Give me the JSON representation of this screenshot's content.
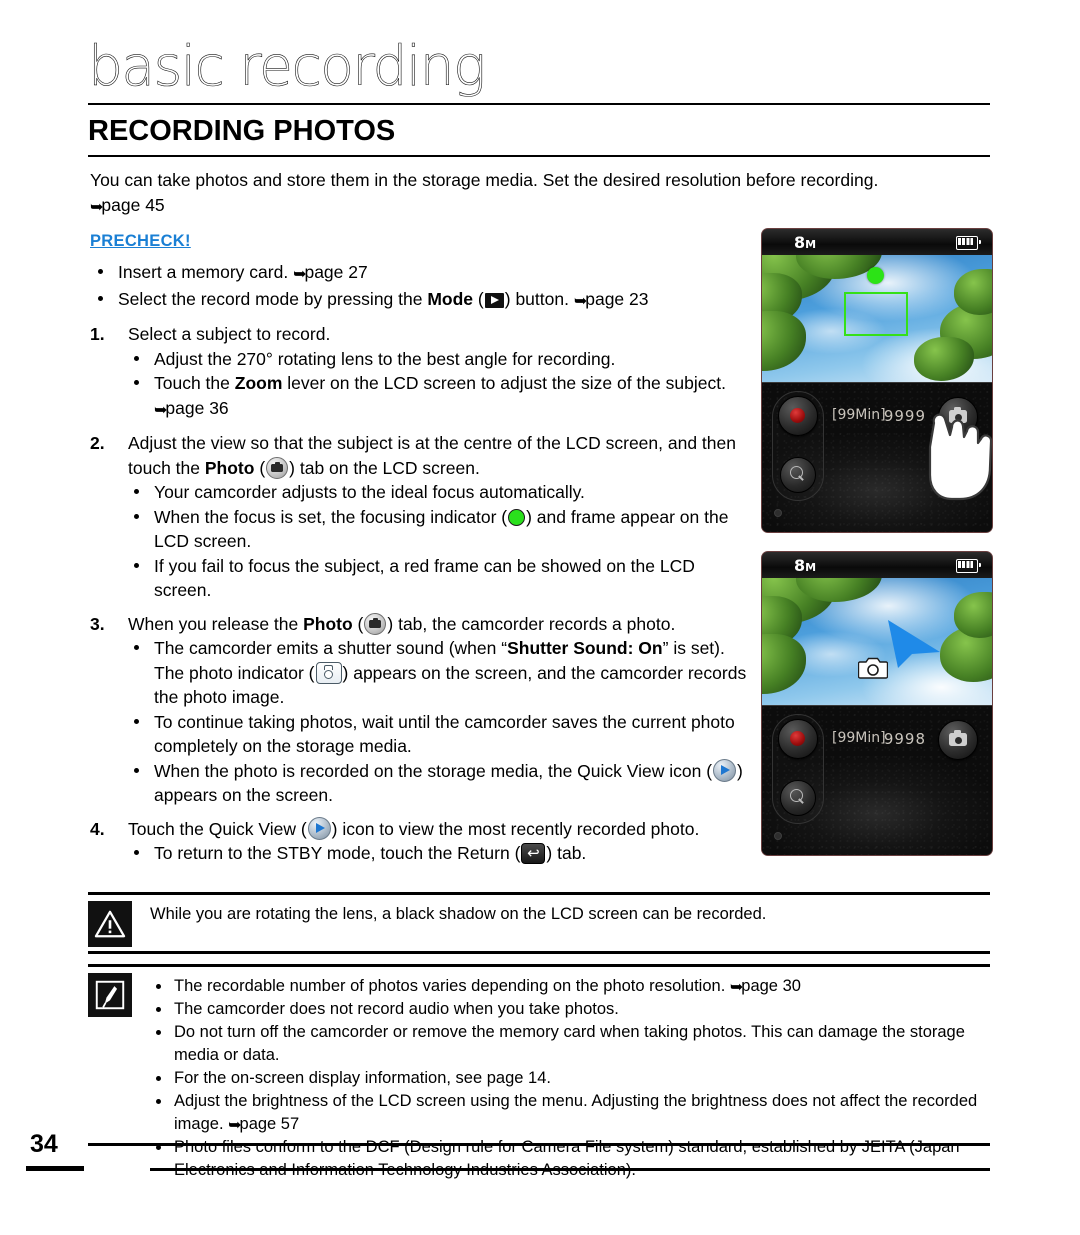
{
  "header": {
    "chapter": "basic recording",
    "section": "RECORDING PHOTOS"
  },
  "intro": {
    "line1": "You can take photos and store them in the storage media. Set the desired resolution before recording.",
    "ref": "page 45"
  },
  "precheck": {
    "label": "PRECHECK!",
    "items": [
      {
        "pre": "Insert a memory card. ",
        "ref": "page 27",
        "post": ""
      },
      {
        "pre": "Select the record mode by pressing the ",
        "bold": "Mode",
        "icon": "mode-play-icon",
        "mid": " button. ",
        "ref": "page 23",
        "post": ""
      }
    ]
  },
  "steps": [
    {
      "num": "1.",
      "text": "Select a subject to record.",
      "bullets": [
        {
          "pre": "Adjust the 270° rotating lens to the best angle for recording.",
          "post": ""
        },
        {
          "pre": "Touch the ",
          "bold": "Zoom",
          "mid": " lever on the LCD screen to adjust the size of the subject. ",
          "ref": "page 36",
          "post": ""
        }
      ]
    },
    {
      "num": "2.",
      "pre": "Adjust the view so that the subject is at the centre of the LCD screen, and then touch the ",
      "bold": "Photo",
      "icon": "photo-tab-icon",
      "post": ") tab on the LCD screen.",
      "bullets": [
        {
          "pre": "Your camcorder adjusts to the ideal focus automatically.",
          "post": ""
        },
        {
          "pre": "When the focus is set, the focusing indicator (",
          "icon": "green-focus-icon",
          "post": ") and frame appear on the LCD screen."
        },
        {
          "pre": "If you fail to focus the subject, a red frame can be showed on the LCD screen.",
          "post": ""
        }
      ]
    },
    {
      "num": "3.",
      "pre": "When you release the ",
      "bold": "Photo",
      "icon": "photo-tab-icon",
      "post": ") tab, the camcorder records a photo.",
      "bullets": [
        {
          "pre": "The camcorder emits a shutter sound (when “",
          "bold": "Shutter Sound: On",
          "mid": "” is set). The photo indicator (",
          "icon": "photo-indicator-icon",
          "post": ") appears on the screen, and the camcorder records the photo image."
        },
        {
          "pre": "To continue taking photos, wait until the camcorder saves the current photo completely on the storage media.",
          "post": ""
        },
        {
          "pre": "When the photo is recorded on the storage media, the Quick View icon (",
          "icon": "quick-view-icon",
          "post": ") appears on the screen."
        }
      ]
    },
    {
      "num": "4.",
      "pre": "Touch the Quick View (",
      "icon": "quick-view-icon",
      "post": ") icon to view the most recently recorded photo.",
      "bullets": [
        {
          "pre": "To return to the STBY mode, touch the Return (",
          "icon": "return-icon",
          "post": ") tab."
        }
      ]
    }
  ],
  "lcd_screens": [
    {
      "name": "focus-preview",
      "resolution": "8",
      "resolution_unit": "M",
      "battery": "battery-full-icon",
      "rec_time": "[99Min]",
      "photo_count": "9999",
      "overlay": "green-focus-frame",
      "has_hand_cursor": true
    },
    {
      "name": "photo-captured",
      "resolution": "8",
      "resolution_unit": "M",
      "battery": "battery-full-icon",
      "rec_time": "[99Min]",
      "photo_count": "9998",
      "overlay": "photo-captured-icon",
      "has_hand_cursor": false
    }
  ],
  "warning": {
    "icon": "warning-triangle-icon",
    "text": "While you are rotating the lens, a black shadow on the LCD screen can be recorded."
  },
  "notes": {
    "icon": "note-pen-icon",
    "items": [
      {
        "pre": "The recordable number of photos varies depending on the photo resolution. ",
        "ref": "page 30",
        "post": ""
      },
      {
        "pre": "The camcorder does not record audio when you take photos.",
        "post": ""
      },
      {
        "pre": "Do not turn off the camcorder or remove the memory card when taking photos. This can damage the storage media or data.",
        "post": ""
      },
      {
        "pre": "For the on-screen display information, see page 14.",
        "post": ""
      },
      {
        "pre": "Adjust the brightness of the LCD screen using the menu. Adjusting the brightness does not affect the recorded image. ",
        "ref": "page 57",
        "post": ""
      },
      {
        "pre": "Photo files conform to the DCF (Design rule for Camera File system) standard, established by JEITA (Japan Electronics and Information Technology Industries Association).",
        "post": ""
      }
    ]
  },
  "footer": {
    "page_number": "34"
  },
  "colors": {
    "precheck_blue": "#1a7fd4",
    "focus_green": "#2ce316",
    "quickview_blue": "#1f77d0"
  }
}
